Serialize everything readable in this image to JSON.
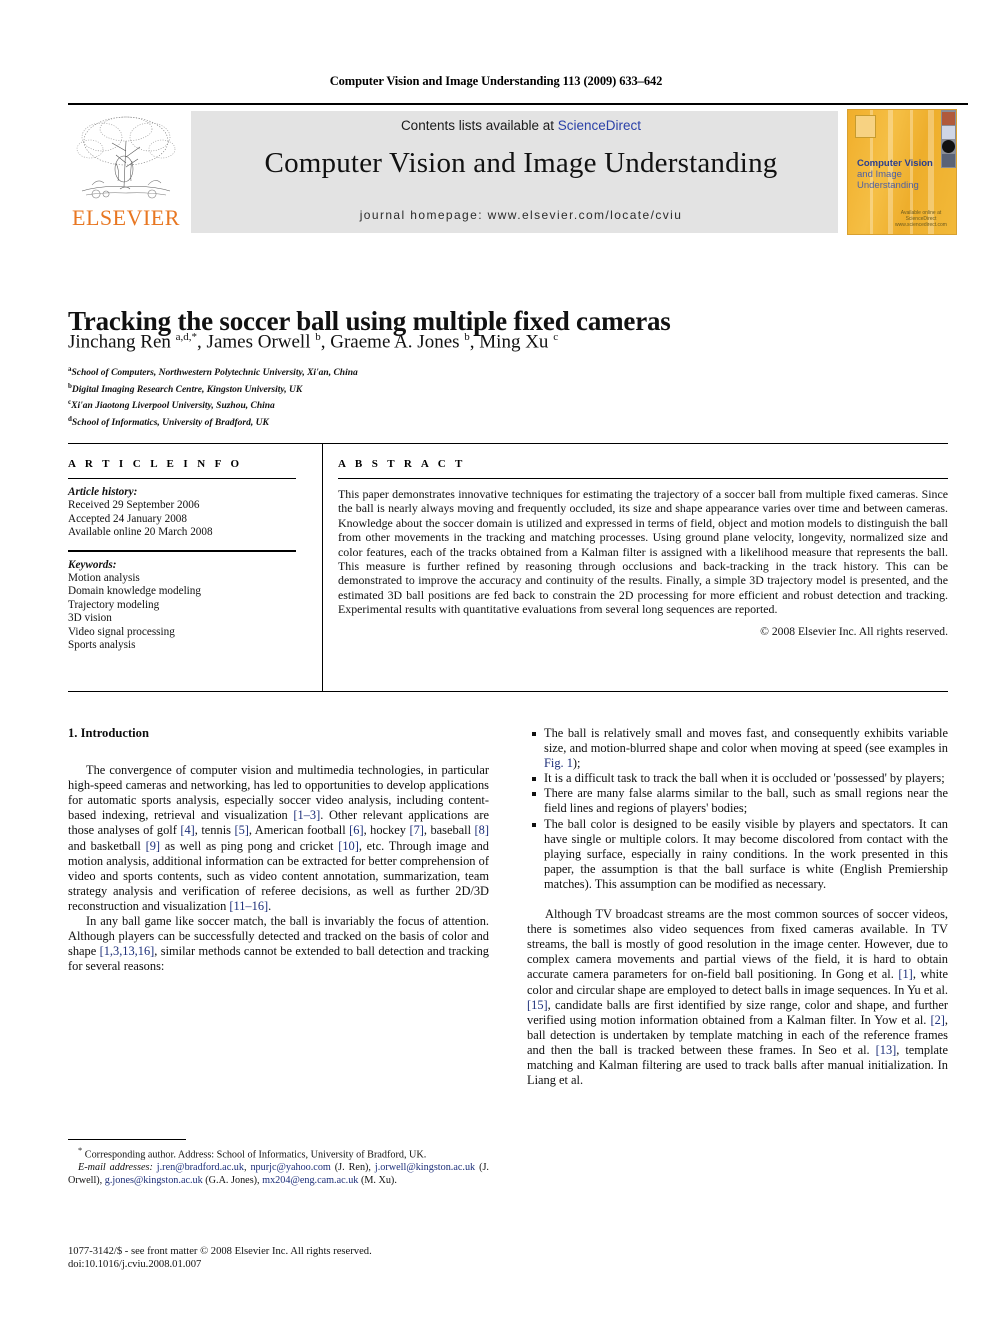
{
  "running_head": "Computer Vision and Image Understanding 113 (2009) 633–642",
  "masthead": {
    "publisher_name": "ELSEVIER",
    "contents_prefix": "Contents lists available at ",
    "contents_link": "ScienceDirect",
    "journal_title": "Computer Vision and Image Understanding",
    "homepage": "journal homepage: www.elsevier.com/locate/cviu",
    "cover": {
      "title_line1": "Computer Vision",
      "title_line2": "and Image",
      "title_line3": "Understanding",
      "footer_line1": "Available online at",
      "footer_line2": "ScienceDirect",
      "footer_line3": "www.sciencedirect.com"
    },
    "colors": {
      "elsevier_orange": "#E87722",
      "link_blue": "#2b41a8",
      "band_gray": "#e3e3e3",
      "cover_gold": "#f0ae2b",
      "cover_title_blue": "#2a3f8f"
    }
  },
  "article": {
    "title": "Tracking the soccer ball using multiple fixed cameras",
    "authors_html": "Jinchang Ren <sup>a,d,*</sup>, James Orwell <sup>b</sup>, Graeme A. Jones <sup>b</sup>, Ming Xu <sup>c</sup>",
    "affiliations": [
      {
        "marker": "a",
        "text": "School of Computers, Northwestern Polytechnic University, Xi'an, China"
      },
      {
        "marker": "b",
        "text": "Digital Imaging Research Centre, Kingston University, UK"
      },
      {
        "marker": "c",
        "text": "Xi'an Jiaotong Liverpool University, Suzhou, China"
      },
      {
        "marker": "d",
        "text": "School of Informatics, University of Bradford, UK"
      }
    ]
  },
  "article_info": {
    "heading": "A R T I C L E  I N F O",
    "history_label": "Article history:",
    "history": [
      "Received 29 September 2006",
      "Accepted 24 January 2008",
      "Available online 20 March 2008"
    ],
    "keywords_label": "Keywords:",
    "keywords": [
      "Motion analysis",
      "Domain knowledge modeling",
      "Trajectory modeling",
      "3D vision",
      "Video signal processing",
      "Sports analysis"
    ]
  },
  "abstract": {
    "heading": "A B S T R A C T",
    "text": "This paper demonstrates innovative techniques for estimating the trajectory of a soccer ball from multiple fixed cameras. Since the ball is nearly always moving and frequently occluded, its size and shape appearance varies over time and between cameras. Knowledge about the soccer domain is utilized and expressed in terms of field, object and motion models to distinguish the ball from other movements in the tracking and matching processes. Using ground plane velocity, longevity, normalized size and color features, each of the tracks obtained from a Kalman filter is assigned with a likelihood measure that represents the ball. This measure is further refined by reasoning through occlusions and back-tracking in the track history. This can be demonstrated to improve the accuracy and continuity of the results. Finally, a simple 3D trajectory model is presented, and the estimated 3D ball positions are fed back to constrain the 2D processing for more efficient and robust detection and tracking. Experimental results with quantitative evaluations from several long sequences are reported.",
    "copyright": "© 2008 Elsevier Inc. All rights reserved."
  },
  "body": {
    "section_number_title": "1. Introduction",
    "left_paragraphs": [
      "The convergence of computer vision and multimedia technologies, in particular high-speed cameras and networking, has led to opportunities to develop applications for automatic sports analysis, especially soccer video analysis, including content-based indexing, retrieval and visualization <c>[1–3]</c>. Other relevant applications are those analyses of golf <c>[4]</c>, tennis <c>[5]</c>, American football <c>[6]</c>, hockey <c>[7]</c>, baseball <c>[8]</c> and basketball <c>[9]</c> as well as ping pong and cricket <c>[10]</c>, etc. Through image and motion analysis, additional information can be extracted for better comprehension of video and sports contents, such as video content annotation, summarization, team strategy analysis and verification of referee decisions, as well as further 2D/3D reconstruction and visualization <c>[11–16]</c>.",
      "In any ball game like soccer match, the ball is invariably the focus of attention. Although players can be successfully detected and tracked on the basis of color and shape <c>[1,3,13,16]</c>, similar methods cannot be extended to ball detection and tracking for several reasons:"
    ],
    "bullets": [
      "The ball is relatively small and moves fast, and consequently exhibits variable size, and motion-blurred shape and color when moving at speed (see examples in <c>Fig. 1</c>);",
      "It is a difficult task to track the ball when it is occluded or 'possessed' by players;",
      "There are many false alarms similar to the ball, such as small regions near the field lines and regions of players' bodies;",
      "The ball color is designed to be easily visible by players and spectators. It can have single or multiple colors. It may become discolored from contact with the playing surface, especially in rainy conditions. In the work presented in this paper, the assumption is that the ball surface is white (English Premiership matches). This assumption can be modified as necessary."
    ],
    "right_paragraphs": [
      "Although TV broadcast streams are the most common sources of soccer videos, there is sometimes also video sequences from fixed cameras available. In TV streams, the ball is mostly of good resolution in the image center. However, due to complex camera movements and partial views of the field, it is hard to obtain accurate camera parameters for on-field ball positioning. In Gong et al. <c>[1]</c>, white color and circular shape are employed to detect balls in image sequences. In Yu et al. <c>[15]</c>, candidate balls are first identified by size range, color and shape, and further verified using motion information obtained from a Kalman filter. In Yow et al. <c>[2]</c>, ball detection is undertaken by template matching in each of the reference frames and then the ball is tracked between these frames. In Seo et al. <c>[13]</c>, template matching and Kalman filtering are used to track balls after manual initialization. In Liang et al."
    ]
  },
  "footnotes": {
    "corresponding": "<sup>*</sup> Corresponding author. Address: School of Informatics, University of Bradford, UK.",
    "email_label": "E-mail addresses:",
    "emails": "<m>j.ren@bradford.ac.uk</m>, <m>npurjc@yahoo.com</m> (J. Ren), <m>j.orwell@kingston.ac.uk</m> (J. Orwell), <m>g.jones@kingston.ac.uk</m> (G.A. Jones), <m>mx204@eng.cam.ac.uk</m> (M. Xu)."
  },
  "imprint": {
    "line1": "1077-3142/$ - see front matter © 2008 Elsevier Inc. All rights reserved.",
    "line2": "doi:10.1016/j.cviu.2008.01.007"
  }
}
